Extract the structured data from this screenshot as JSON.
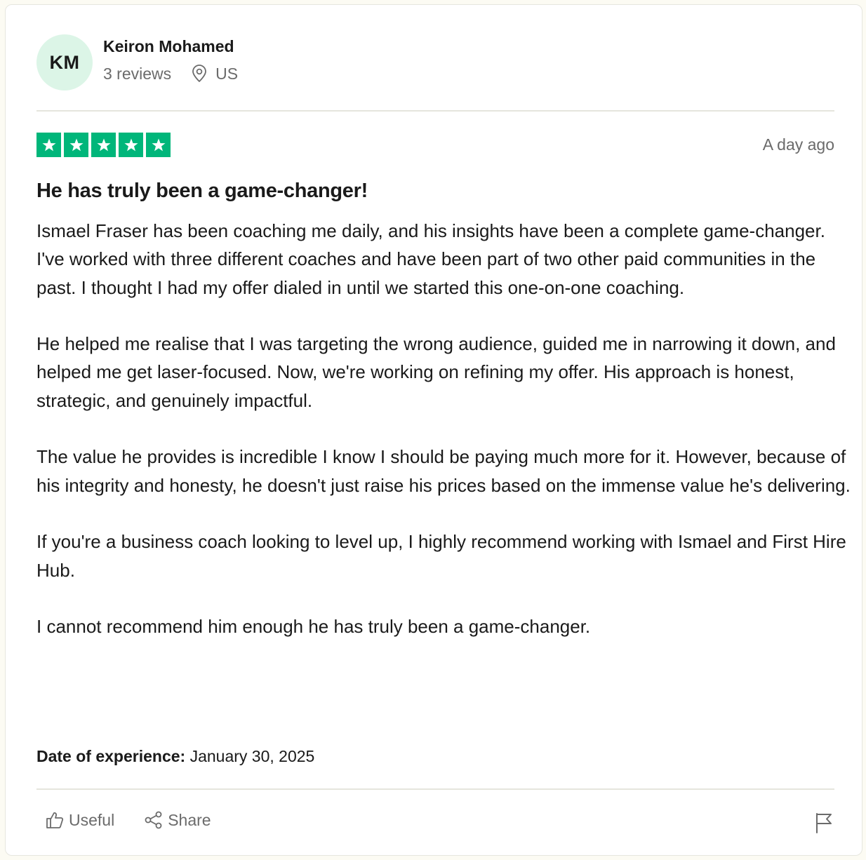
{
  "consumer": {
    "initials": "KM",
    "name": "Keiron Mohamed",
    "reviews_count": "3 reviews",
    "location": "US",
    "avatar_bg": "#dcf5e7"
  },
  "review": {
    "rating": 5,
    "rating_max": 5,
    "star_color": "#00b67a",
    "date": "A day ago",
    "title": "He has truly been a game-changer!",
    "body": "Ismael Fraser has been coaching me daily, and his insights have been a complete game-changer.\nI've worked with three different coaches and have been part of two other paid communities in the past. I thought I had my offer dialed in until we started this one-on-one coaching.\n\nHe helped me realise that I was targeting the wrong audience, guided me in narrowing it down, and helped me get laser-focused. Now, we're working on refining my offer. His approach is honest, strategic, and genuinely impactful.\n\nThe value he provides is incredible I know I should be paying much more for it. However, because of his integrity and honesty, he doesn't just raise his prices based on the immense value he's delivering.\n\nIf you're a business coach looking to level up, I highly recommend working with Ismael and First Hire Hub.\n\nI cannot recommend him enough he has truly been a game-changer.",
    "experience_label": "Date of experience:",
    "experience_date": "January 30, 2025"
  },
  "actions": {
    "useful_label": "Useful",
    "share_label": "Share",
    "useful_icon": "thumbs-up-icon",
    "share_icon": "share-icon",
    "report_icon": "flag-icon"
  }
}
